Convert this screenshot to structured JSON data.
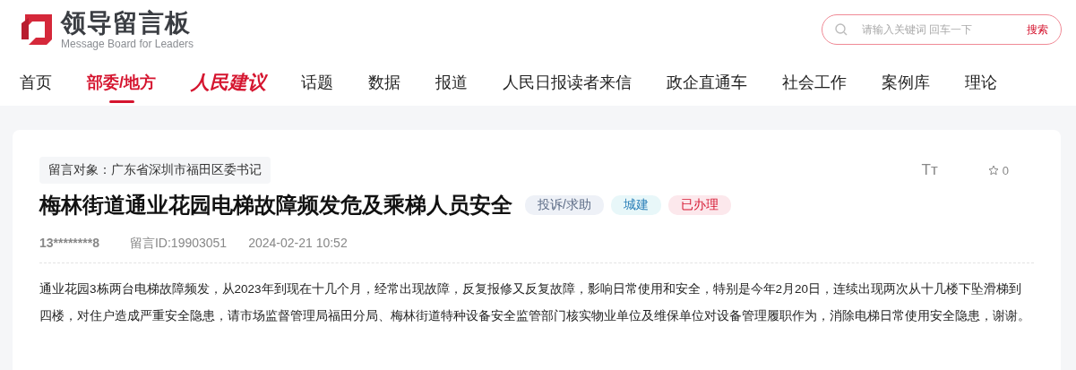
{
  "logo": {
    "title": "领导留言板",
    "subtitle": "Message Board for Leaders"
  },
  "search": {
    "placeholder": "请输入关键词 回车一下",
    "button": "搜索"
  },
  "nav": [
    {
      "label": "首页",
      "selected": false,
      "kind": "plain"
    },
    {
      "label": "部委/地方",
      "selected": true,
      "kind": "plain"
    },
    {
      "label": "人民建议",
      "selected": false,
      "kind": "brand"
    },
    {
      "label": "话题",
      "selected": false,
      "kind": "plain"
    },
    {
      "label": "数据",
      "selected": false,
      "kind": "plain"
    },
    {
      "label": "报道",
      "selected": false,
      "kind": "plain"
    },
    {
      "label": "人民日报读者来信",
      "selected": false,
      "kind": "plain"
    },
    {
      "label": "政企直通车",
      "selected": false,
      "kind": "plain"
    },
    {
      "label": "社会工作",
      "selected": false,
      "kind": "plain"
    },
    {
      "label": "案例库",
      "selected": false,
      "kind": "plain"
    },
    {
      "label": "理论",
      "selected": false,
      "kind": "plain"
    }
  ],
  "message": {
    "target": "留言对象：广东省深圳市福田区委书记",
    "title": "梅林街道通业花园电梯故障频发危及乘梯人员安全",
    "tags": [
      {
        "label": "投诉/求助",
        "color": "#eef1f7"
      },
      {
        "label": "城建",
        "color": "#e8f7f9"
      },
      {
        "label": "已办理",
        "color": "#fce8ec"
      }
    ],
    "font_toggle": "Tт",
    "favorites": "0",
    "author": "13********8",
    "message_id": "留言ID:19903051",
    "time": "2024-02-21 10:52",
    "body": "通业花园3栋两台电梯故障频发，从2023年到现在十几个月，经常出现故障，反复报修又反复故障，影响日常使用和安全，特别是今年2月20日，连续出现两次从十几楼下坠滑梯到四楼，对住户造成严重安全隐患，请市场监督管理局福田分局、梅林街道特种设备安全监管部门核实物业单位及维保单位对设备管理履职作为，消除电梯日常使用安全隐患，谢谢。"
  }
}
